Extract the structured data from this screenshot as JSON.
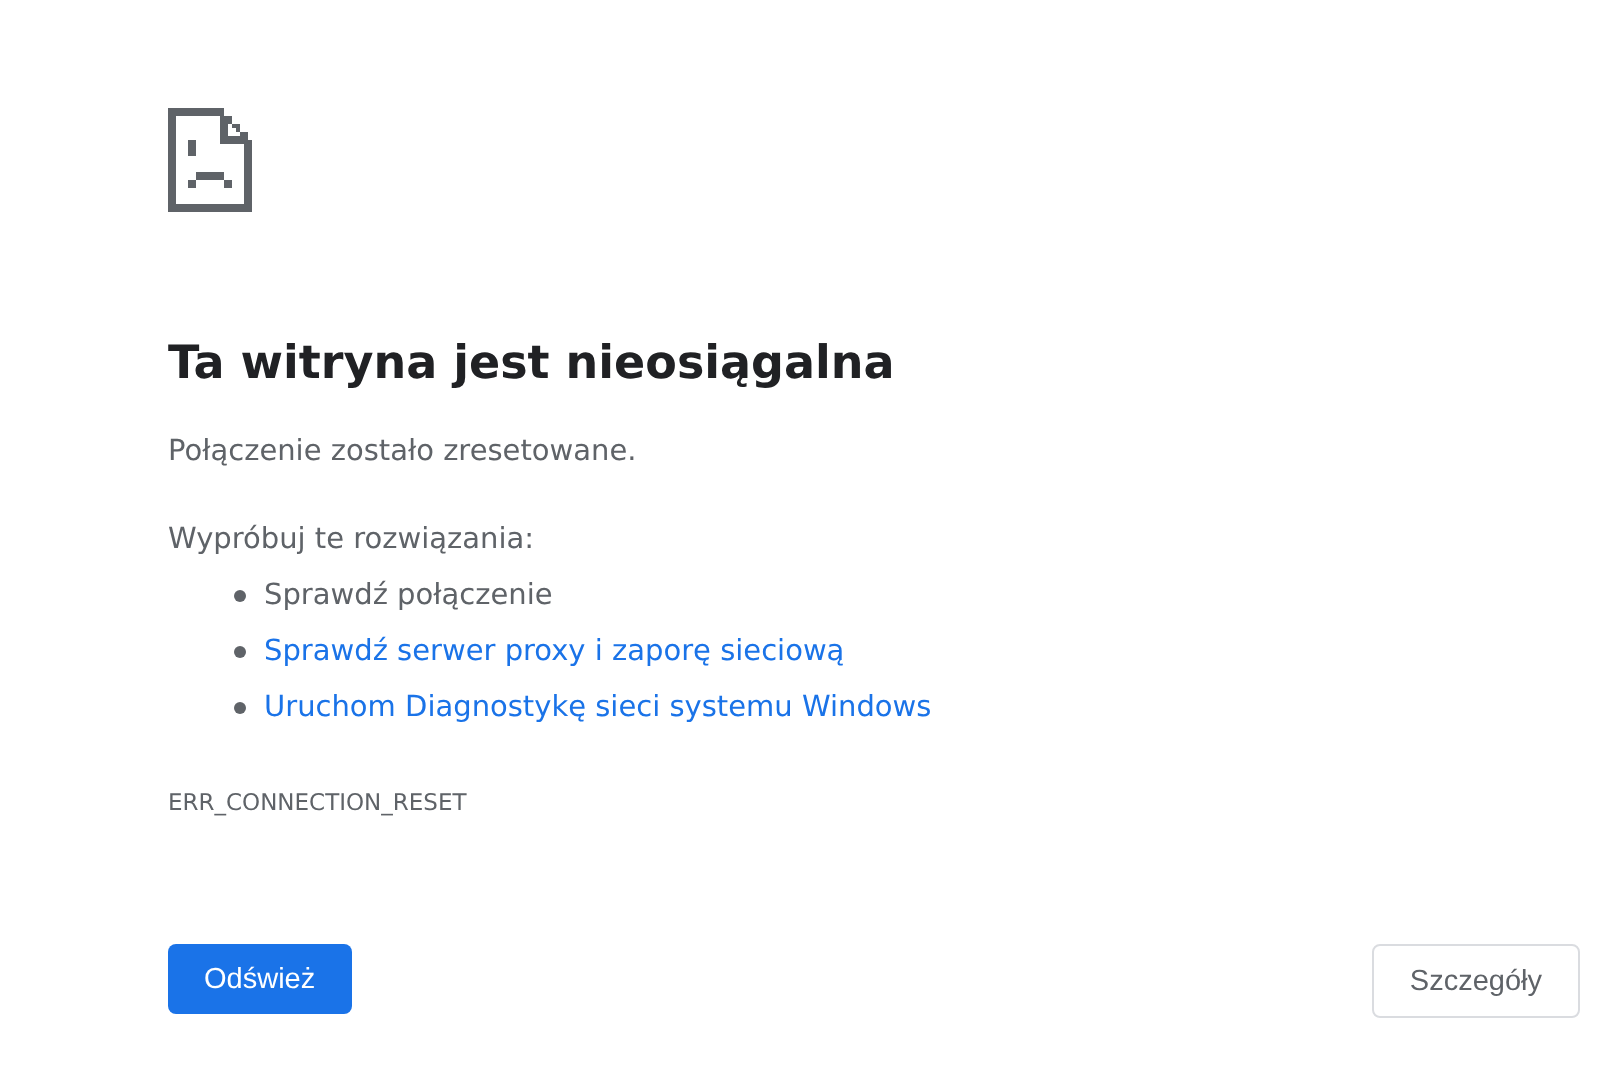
{
  "title": "Ta witryna jest nieosiągalna",
  "message": "Połączenie zostało zresetowane.",
  "suggestions_heading": "Wypróbuj te rozwiązania:",
  "suggestions": [
    {
      "text": "Sprawdź połączenie",
      "kind": "text"
    },
    {
      "text": "Sprawdź serwer proxy i zaporę sieciową",
      "kind": "link"
    },
    {
      "text": "Uruchom Diagnostykę sieci systemu Windows",
      "kind": "link"
    }
  ],
  "error_code": "ERR_CONNECTION_RESET",
  "buttons": [
    {
      "label": "Odśwież",
      "kind": "primary"
    },
    {
      "label": "Szczegóły",
      "kind": "secondary"
    }
  ]
}
